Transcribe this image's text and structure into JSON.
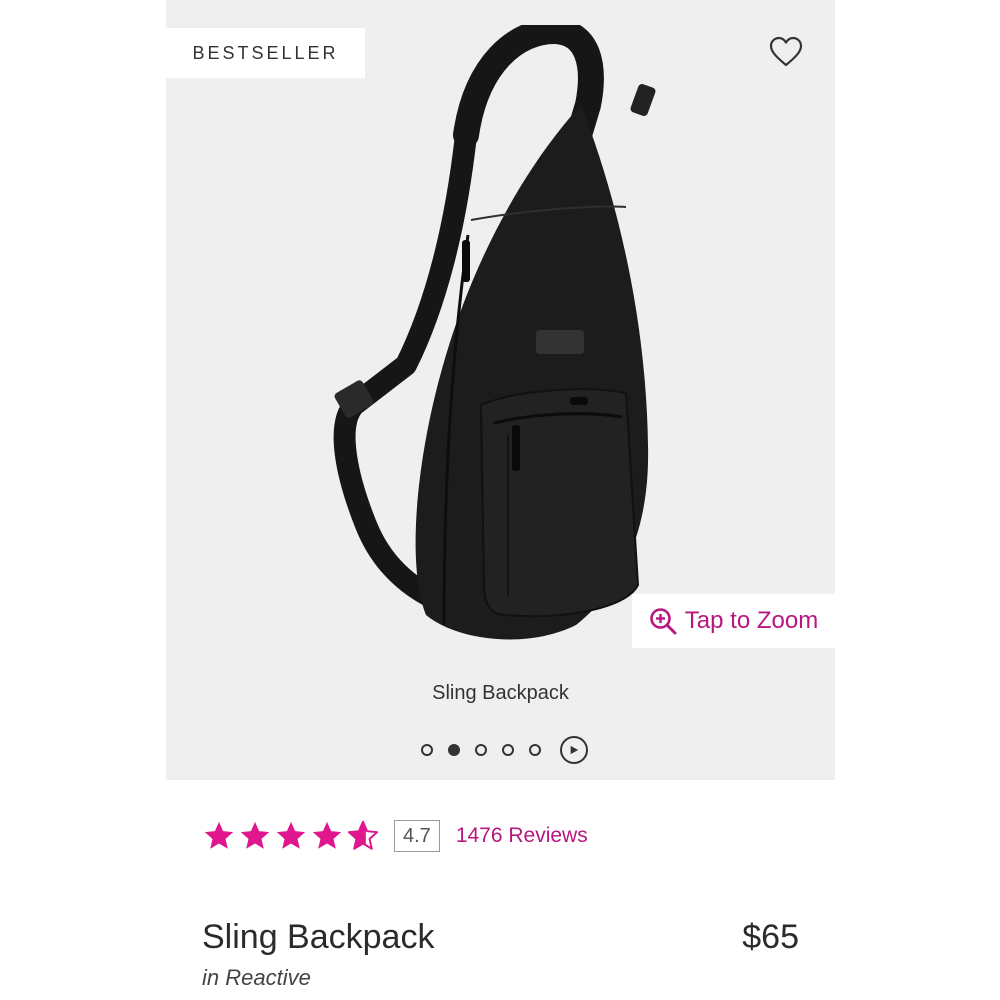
{
  "badge": {
    "label": "BESTSELLER"
  },
  "icons": {
    "wishlist": "heart-icon",
    "zoom": "zoom-in-icon",
    "play": "play-icon",
    "star": "star-icon"
  },
  "gallery": {
    "zoom_label": "Tap to Zoom",
    "caption": "Sling Backpack",
    "dots_count": 5,
    "active_dot": 2
  },
  "rating": {
    "value": 4.7,
    "value_label": "4.7",
    "max": 5,
    "reviews_label": "1476 Reviews"
  },
  "product": {
    "name": "Sling Backpack",
    "price": "$65",
    "variant": "in Reactive"
  },
  "colors": {
    "accent": "#E0168E",
    "link": "#B8177F",
    "gallery_bg": "#EFEFEF"
  }
}
